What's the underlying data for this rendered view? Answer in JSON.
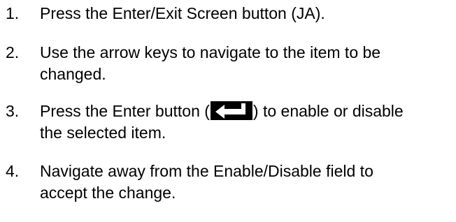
{
  "steps": [
    {
      "number": "1.",
      "lines": [
        "Press the Enter/Exit Screen button (JA)."
      ]
    },
    {
      "number": "2.",
      "lines": [
        "Use the arrow keys to navigate to the item to be",
        "changed."
      ]
    },
    {
      "number": "3.",
      "line1_before": "Press the Enter button (",
      "line1_after": ") to enable or disable",
      "line2": "the selected item.",
      "icon": "enter-key-icon"
    },
    {
      "number": "4.",
      "lines": [
        "Navigate away from the Enable/Disable field to",
        "accept the change."
      ]
    }
  ]
}
